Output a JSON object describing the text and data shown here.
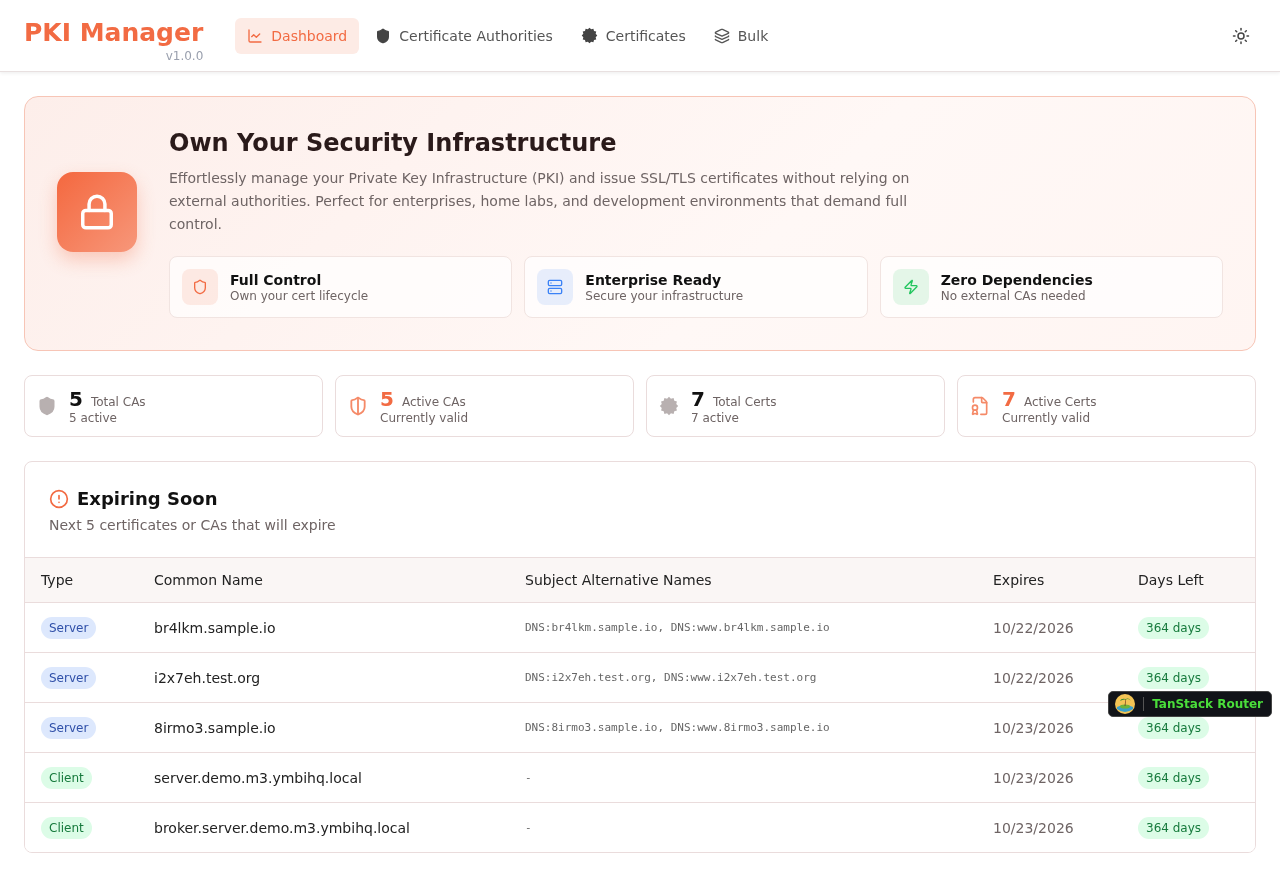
{
  "brand": {
    "title": "PKI Manager",
    "version": "v1.0.0"
  },
  "nav": [
    {
      "label": "Dashboard",
      "selected": true
    },
    {
      "label": "Certificate Authorities",
      "selected": false
    },
    {
      "label": "Certificates",
      "selected": false
    },
    {
      "label": "Bulk",
      "selected": false
    }
  ],
  "hero": {
    "title": "Own Your Security Infrastructure",
    "description": "Effortlessly manage your Private Key Infrastructure (PKI) and issue SSL/TLS certificates without relying on external authorities. Perfect for enterprises, home labs, and development environments that demand full control.",
    "features": [
      {
        "title": "Full Control",
        "subtitle": "Own your cert lifecycle",
        "color": "#f26b43"
      },
      {
        "title": "Enterprise Ready",
        "subtitle": "Secure your infrastructure",
        "color": "#3b82f6"
      },
      {
        "title": "Zero Dependencies",
        "subtitle": "No external CAs needed",
        "color": "#22c55e"
      }
    ]
  },
  "stats": [
    {
      "value": "5",
      "label": "Total CAs",
      "sub": "5 active",
      "accent": false
    },
    {
      "value": "5",
      "label": "Active CAs",
      "sub": "Currently valid",
      "accent": true
    },
    {
      "value": "7",
      "label": "Total Certs",
      "sub": "7 active",
      "accent": false
    },
    {
      "value": "7",
      "label": "Active Certs",
      "sub": "Currently valid",
      "accent": true
    }
  ],
  "expiring": {
    "title": "Expiring Soon",
    "subtitle": "Next 5 certificates or CAs that will expire",
    "columns": [
      "Type",
      "Common Name",
      "Subject Alternative Names",
      "Expires",
      "Days Left"
    ],
    "rows": [
      {
        "type": "Server",
        "kind": "server",
        "name": "br4lkm.sample.io",
        "sans": "DNS:br4lkm.sample.io, DNS:www.br4lkm.sample.io",
        "expires": "10/22/2026",
        "days": "364 days"
      },
      {
        "type": "Server",
        "kind": "server",
        "name": "i2x7eh.test.org",
        "sans": "DNS:i2x7eh.test.org, DNS:www.i2x7eh.test.org",
        "expires": "10/22/2026",
        "days": "364 days"
      },
      {
        "type": "Server",
        "kind": "server",
        "name": "8irmo3.sample.io",
        "sans": "DNS:8irmo3.sample.io, DNS:www.8irmo3.sample.io",
        "expires": "10/23/2026",
        "days": "364 days"
      },
      {
        "type": "Client",
        "kind": "client",
        "name": "server.demo.m3.ymbihq.local",
        "sans": "-",
        "expires": "10/23/2026",
        "days": "364 days"
      },
      {
        "type": "Client",
        "kind": "client",
        "name": "broker.server.demo.m3.ymbihq.local",
        "sans": "-",
        "expires": "10/23/2026",
        "days": "364 days"
      }
    ]
  },
  "devtools": {
    "label": "TanStack Router"
  }
}
